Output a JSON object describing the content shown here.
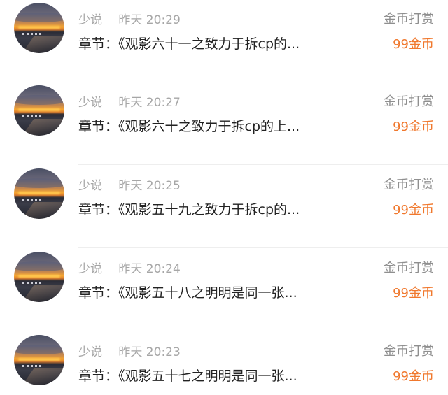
{
  "list": {
    "items": [
      {
        "name": "少说",
        "time": "昨天 20:29",
        "reward_type": "金币打赏",
        "chapter": "章节：《观影六十一之致力于拆cp的...",
        "amount": "99金币"
      },
      {
        "name": "少说",
        "time": "昨天 20:27",
        "reward_type": "金币打赏",
        "chapter": "章节：《观影六十之致力于拆cp的上...",
        "amount": "99金币"
      },
      {
        "name": "少说",
        "time": "昨天 20:25",
        "reward_type": "金币打赏",
        "chapter": "章节：《观影五十九之致力于拆cp的...",
        "amount": "99金币"
      },
      {
        "name": "少说",
        "time": "昨天 20:24",
        "reward_type": "金币打赏",
        "chapter": "章节：《观影五十八之明明是同一张...",
        "amount": "99金币"
      },
      {
        "name": "少说",
        "time": "昨天 20:23",
        "reward_type": "金币打赏",
        "chapter": "章节：《观影五十七之明明是同一张...",
        "amount": "99金币"
      }
    ]
  },
  "colors": {
    "accent": "#f0782d",
    "meta_text": "#a6a6a6",
    "primary_text": "#222222",
    "divider": "#eeeeee"
  }
}
